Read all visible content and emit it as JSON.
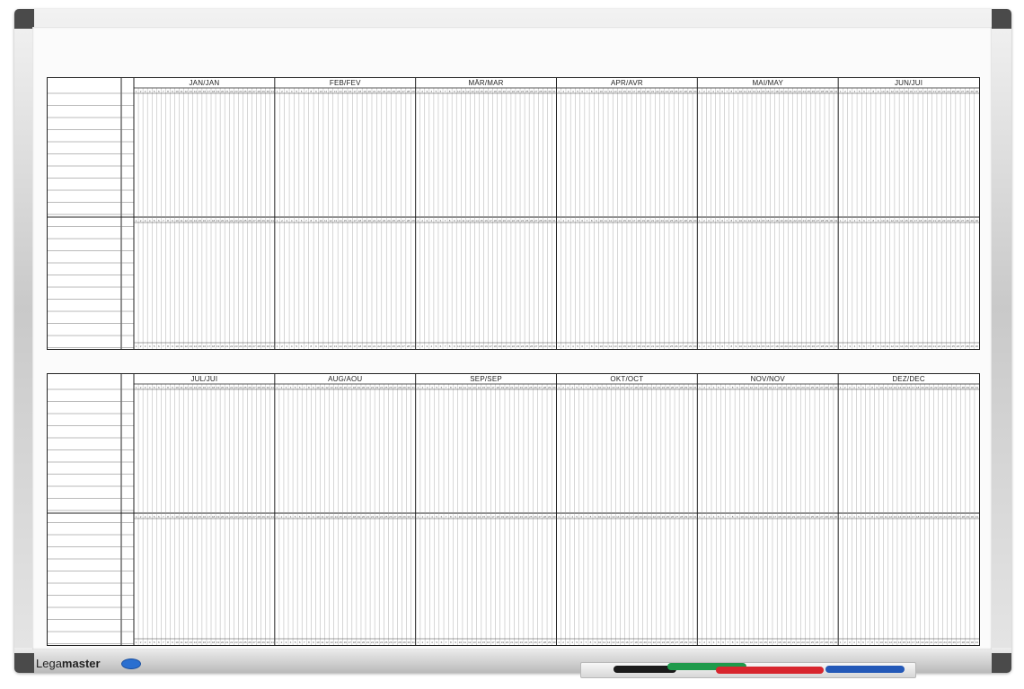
{
  "board": {
    "brand_prefix": "Lega",
    "brand_suffix": "master",
    "logo_icon": "legamaster-logo-icon"
  },
  "planner_top": {
    "months": [
      {
        "label": "JAN/JAN",
        "days": 31
      },
      {
        "label": "FEB/FEV",
        "days": 29
      },
      {
        "label": "MÄR/MAR",
        "days": 31
      },
      {
        "label": "APR/AVR",
        "days": 30
      },
      {
        "label": "MAI/MAY",
        "days": 31
      },
      {
        "label": "JUN/JUI",
        "days": 30
      }
    ]
  },
  "planner_bottom": {
    "months": [
      {
        "label": "JUL/JUI",
        "days": 31
      },
      {
        "label": "AUG/AOU",
        "days": 31
      },
      {
        "label": "SEP/SEP",
        "days": 30
      },
      {
        "label": "OKT/OCT",
        "days": 31
      },
      {
        "label": "NOV/NOV",
        "days": 30
      },
      {
        "label": "DEZ/DEC",
        "days": 31
      }
    ]
  },
  "markers": [
    {
      "name": "black-marker",
      "color": "#1b1b1b"
    },
    {
      "name": "green-marker",
      "color": "#1f9a4b"
    },
    {
      "name": "red-marker",
      "color": "#d8262e"
    },
    {
      "name": "blue-marker",
      "color": "#2459b8"
    }
  ]
}
